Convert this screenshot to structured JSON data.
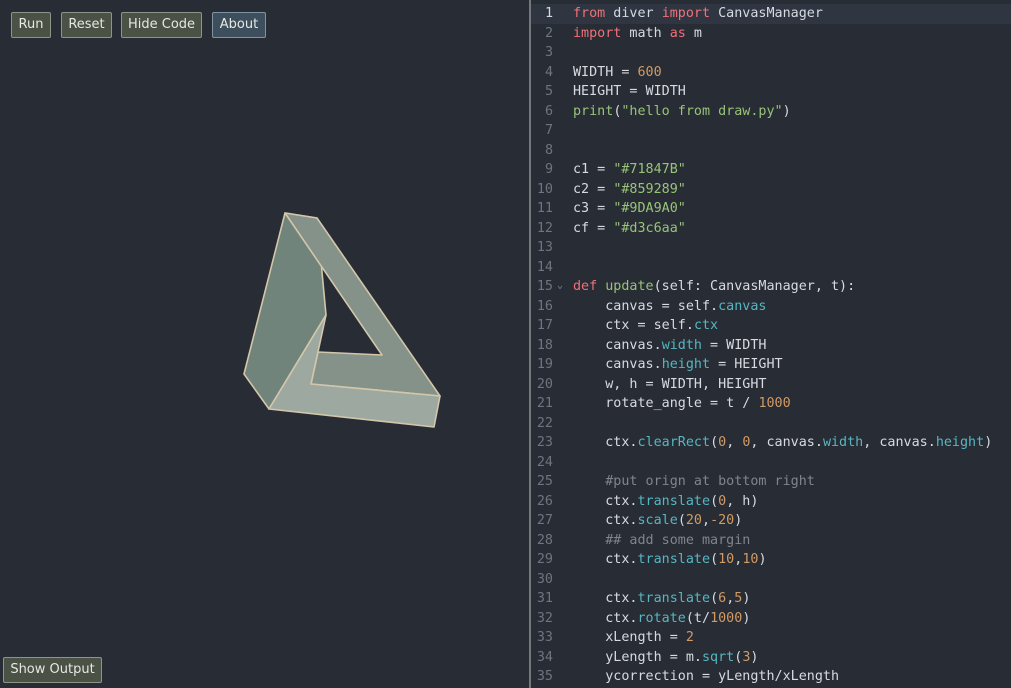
{
  "toolbar": {
    "run_label": "Run",
    "reset_label": "Reset",
    "hide_code_label": "Hide Code",
    "about_label": "About"
  },
  "footer": {
    "show_output_label": "Show Output"
  },
  "colors": {
    "c1": "#71847B",
    "c2": "#859289",
    "c3": "#9DA9A0",
    "cf": "#d3c6aa",
    "background": "#282c34"
  },
  "editor": {
    "active_line": 1,
    "fold_line": 15,
    "lines": [
      {
        "n": "1",
        "tokens": [
          [
            "kw",
            "from"
          ],
          [
            "",
            "  diver "
          ],
          [
            "kw",
            "import"
          ],
          [
            "",
            " CanvasManager"
          ]
        ]
      },
      {
        "n": "2",
        "tokens": [
          [
            "kw",
            "import"
          ],
          [
            "",
            " math "
          ],
          [
            "kw",
            "as"
          ],
          [
            "",
            " m"
          ]
        ]
      },
      {
        "n": "3",
        "tokens": []
      },
      {
        "n": "4",
        "tokens": [
          [
            "",
            "WIDTH = "
          ],
          [
            "num",
            "600"
          ]
        ]
      },
      {
        "n": "5",
        "tokens": [
          [
            "",
            "HEIGHT = WIDTH"
          ]
        ]
      },
      {
        "n": "6",
        "tokens": [
          [
            "str",
            "print"
          ],
          [
            "",
            "("
          ],
          [
            "str",
            "\"hello from draw.py\""
          ],
          [
            "",
            ")"
          ]
        ]
      },
      {
        "n": "7",
        "tokens": []
      },
      {
        "n": "8",
        "tokens": []
      },
      {
        "n": "9",
        "tokens": [
          [
            "",
            "c1 = "
          ],
          [
            "str",
            "\"#71847B\""
          ]
        ]
      },
      {
        "n": "10",
        "tokens": [
          [
            "",
            "c2 = "
          ],
          [
            "str",
            "\"#859289\""
          ]
        ]
      },
      {
        "n": "11",
        "tokens": [
          [
            "",
            "c3 = "
          ],
          [
            "str",
            "\"#9DA9A0\""
          ]
        ]
      },
      {
        "n": "12",
        "tokens": [
          [
            "",
            "cf = "
          ],
          [
            "str",
            "\"#d3c6aa\""
          ]
        ]
      },
      {
        "n": "13",
        "tokens": []
      },
      {
        "n": "14",
        "tokens": []
      },
      {
        "n": "15",
        "tokens": [
          [
            "kw",
            "def"
          ],
          [
            "",
            " "
          ],
          [
            "str",
            "update"
          ],
          [
            "",
            "(self: CanvasManager, t):"
          ]
        ]
      },
      {
        "n": "16",
        "tokens": [
          [
            "",
            "    canvas = self."
          ],
          [
            "prop",
            "canvas"
          ]
        ]
      },
      {
        "n": "17",
        "tokens": [
          [
            "",
            "    ctx = self."
          ],
          [
            "prop",
            "ctx"
          ]
        ]
      },
      {
        "n": "18",
        "tokens": [
          [
            "",
            "    canvas."
          ],
          [
            "prop",
            "width"
          ],
          [
            "",
            " = WIDTH"
          ]
        ]
      },
      {
        "n": "19",
        "tokens": [
          [
            "",
            "    canvas."
          ],
          [
            "prop",
            "height"
          ],
          [
            "",
            " = HEIGHT"
          ]
        ]
      },
      {
        "n": "20",
        "tokens": [
          [
            "",
            "    w, h = WIDTH, HEIGHT"
          ]
        ]
      },
      {
        "n": "21",
        "tokens": [
          [
            "",
            "    rotate_angle = t / "
          ],
          [
            "num",
            "1000"
          ]
        ]
      },
      {
        "n": "22",
        "tokens": []
      },
      {
        "n": "23",
        "tokens": [
          [
            "",
            "    ctx."
          ],
          [
            "prop",
            "clearRect"
          ],
          [
            "",
            "("
          ],
          [
            "num",
            "0"
          ],
          [
            "",
            ", "
          ],
          [
            "num",
            "0"
          ],
          [
            "",
            ", canvas."
          ],
          [
            "prop",
            "width"
          ],
          [
            "",
            ", canvas."
          ],
          [
            "prop",
            "height"
          ],
          [
            "",
            ")"
          ]
        ]
      },
      {
        "n": "24",
        "tokens": []
      },
      {
        "n": "25",
        "tokens": [
          [
            "cmt",
            "    #put orign at bottom right"
          ]
        ]
      },
      {
        "n": "26",
        "tokens": [
          [
            "",
            "    ctx."
          ],
          [
            "prop",
            "translate"
          ],
          [
            "",
            "("
          ],
          [
            "num",
            "0"
          ],
          [
            "",
            ", h)"
          ]
        ]
      },
      {
        "n": "27",
        "tokens": [
          [
            "",
            "    ctx."
          ],
          [
            "prop",
            "scale"
          ],
          [
            "",
            "("
          ],
          [
            "num",
            "20"
          ],
          [
            "",
            ","
          ],
          [
            "num",
            "-20"
          ],
          [
            "",
            ")"
          ]
        ]
      },
      {
        "n": "28",
        "tokens": [
          [
            "cmt",
            "    ## add some margin"
          ]
        ]
      },
      {
        "n": "29",
        "tokens": [
          [
            "",
            "    ctx."
          ],
          [
            "prop",
            "translate"
          ],
          [
            "",
            "("
          ],
          [
            "num",
            "10"
          ],
          [
            "",
            ","
          ],
          [
            "num",
            "10"
          ],
          [
            "",
            ")"
          ]
        ]
      },
      {
        "n": "30",
        "tokens": []
      },
      {
        "n": "31",
        "tokens": [
          [
            "",
            "    ctx."
          ],
          [
            "prop",
            "translate"
          ],
          [
            "",
            "("
          ],
          [
            "num",
            "6"
          ],
          [
            "",
            ","
          ],
          [
            "num",
            "5"
          ],
          [
            "",
            ")"
          ]
        ]
      },
      {
        "n": "32",
        "tokens": [
          [
            "",
            "    ctx."
          ],
          [
            "prop",
            "rotate"
          ],
          [
            "",
            "(t/"
          ],
          [
            "num",
            "1000"
          ],
          [
            "",
            ")"
          ]
        ]
      },
      {
        "n": "33",
        "tokens": [
          [
            "",
            "    xLength = "
          ],
          [
            "num",
            "2"
          ]
        ]
      },
      {
        "n": "34",
        "tokens": [
          [
            "",
            "    yLength = m."
          ],
          [
            "prop",
            "sqrt"
          ],
          [
            "",
            "("
          ],
          [
            "num",
            "3"
          ],
          [
            "",
            ")"
          ]
        ]
      },
      {
        "n": "35",
        "tokens": [
          [
            "",
            "    ycorrection = yLength/xLength"
          ]
        ]
      }
    ]
  }
}
